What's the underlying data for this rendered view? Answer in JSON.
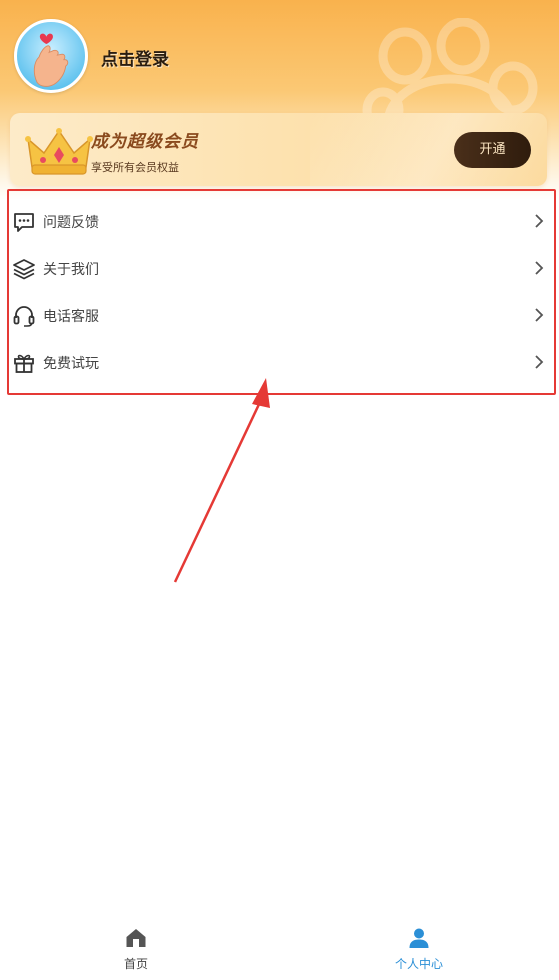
{
  "profile": {
    "login_label": "点击登录"
  },
  "vip": {
    "title": "成为超级会员",
    "subtitle": "享受所有会员权益",
    "button_label": "开通"
  },
  "menu": {
    "items": [
      {
        "label": "问题反馈",
        "icon": "chat-bubble-icon"
      },
      {
        "label": "关于我们",
        "icon": "layers-icon"
      },
      {
        "label": "电话客服",
        "icon": "headset-icon"
      },
      {
        "label": "免费试玩",
        "icon": "gift-icon"
      }
    ]
  },
  "annotation": {
    "highlight_color": "#e53935"
  },
  "tabbar": {
    "home_label": "首页",
    "profile_label": "个人中心",
    "active_color": "#2b8fd6"
  }
}
